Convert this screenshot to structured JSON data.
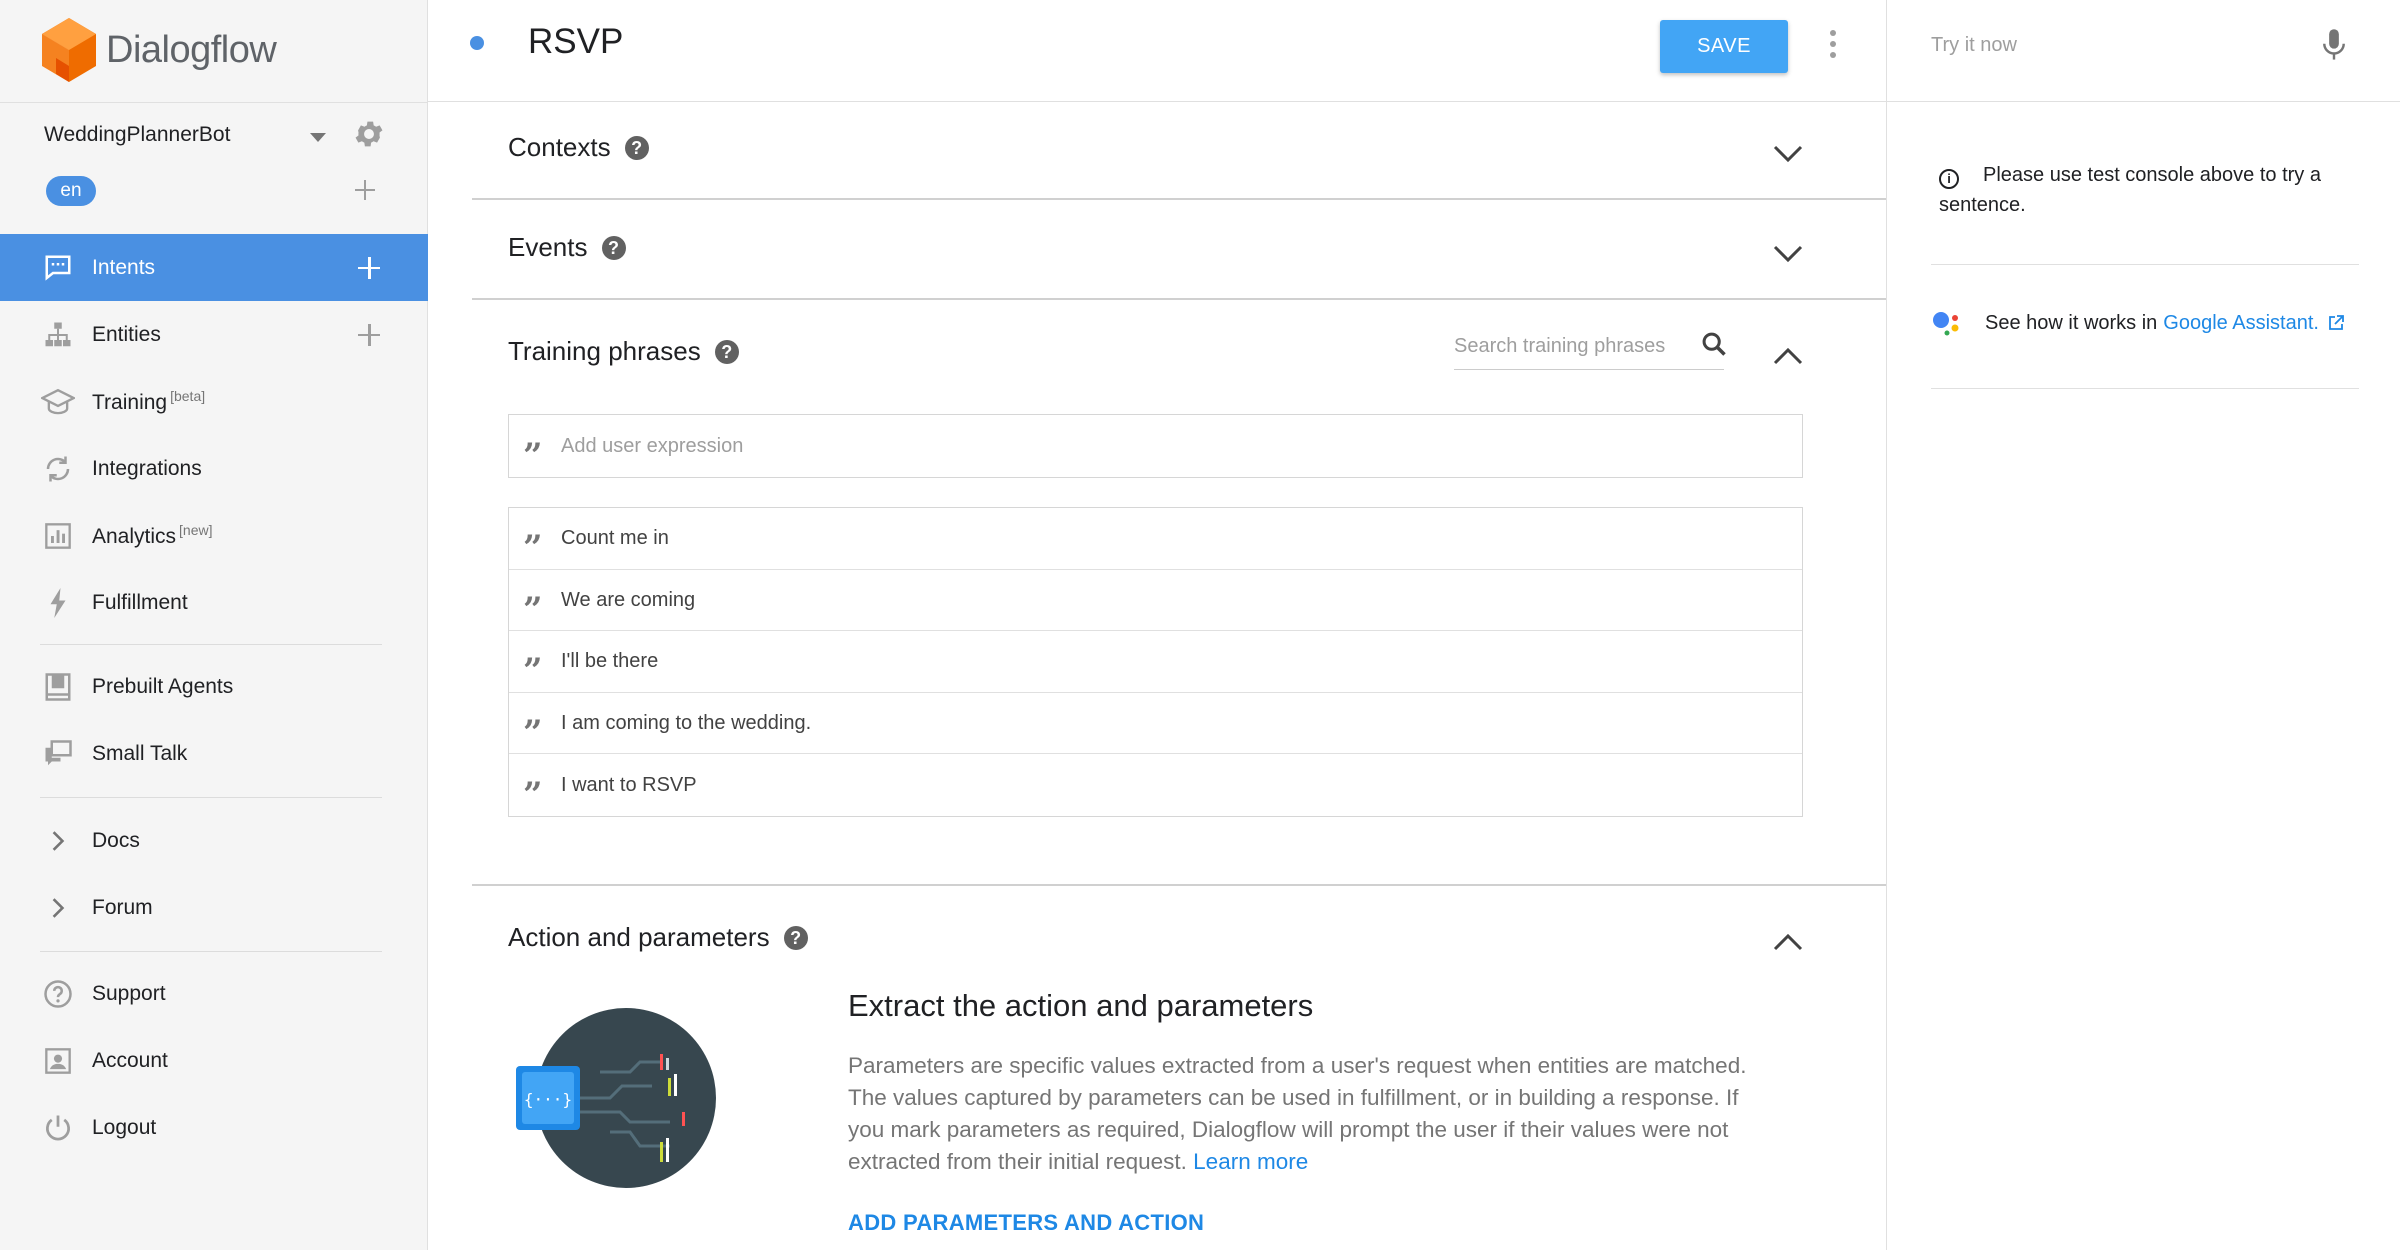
{
  "brand": {
    "name": "Dialogflow"
  },
  "agent": {
    "name": "WeddingPlannerBot",
    "language": "en"
  },
  "sidebar": {
    "items": [
      {
        "label": "Intents",
        "tag": ""
      },
      {
        "label": "Entities",
        "tag": ""
      },
      {
        "label": "Training",
        "tag": "[beta]"
      },
      {
        "label": "Integrations",
        "tag": ""
      },
      {
        "label": "Analytics",
        "tag": "[new]"
      },
      {
        "label": "Fulfillment",
        "tag": ""
      },
      {
        "label": "Prebuilt Agents",
        "tag": ""
      },
      {
        "label": "Small Talk",
        "tag": ""
      },
      {
        "label": "Docs",
        "tag": ""
      },
      {
        "label": "Forum",
        "tag": ""
      },
      {
        "label": "Support",
        "tag": ""
      },
      {
        "label": "Account",
        "tag": ""
      },
      {
        "label": "Logout",
        "tag": ""
      }
    ],
    "active": "Intents"
  },
  "header": {
    "intent_name": "RSVP",
    "save_label": "SAVE"
  },
  "sections": {
    "contexts": "Contexts",
    "events": "Events",
    "training_phrases": "Training phrases",
    "action_parameters": "Action and parameters"
  },
  "training": {
    "search_placeholder": "Search training phrases",
    "add_placeholder": "Add user expression",
    "phrases": [
      "Count me in",
      "We are coming",
      "I'll be there",
      "I am coming to the wedding.",
      "I want to RSVP"
    ]
  },
  "action": {
    "title": "Extract the action and parameters",
    "body": "Parameters are specific values extracted from a user's request when entities are matched. The values captured by parameters can be used in fulfillment, or in building a response. If you mark parameters as required, Dialogflow will prompt the user if their values were not extracted from their initial request.",
    "learn_more": "Learn more",
    "add_button": "ADD PARAMETERS AND ACTION"
  },
  "test_console": {
    "placeholder": "Try it now",
    "info": "Please use test console above to try a sentence.",
    "ga_prefix": "See how it works in",
    "ga_link": "Google Assistant."
  },
  "colors": {
    "accent": "#4a90e2",
    "save": "#42a5f5",
    "link": "#1e88e5",
    "logo": "#f58220"
  }
}
